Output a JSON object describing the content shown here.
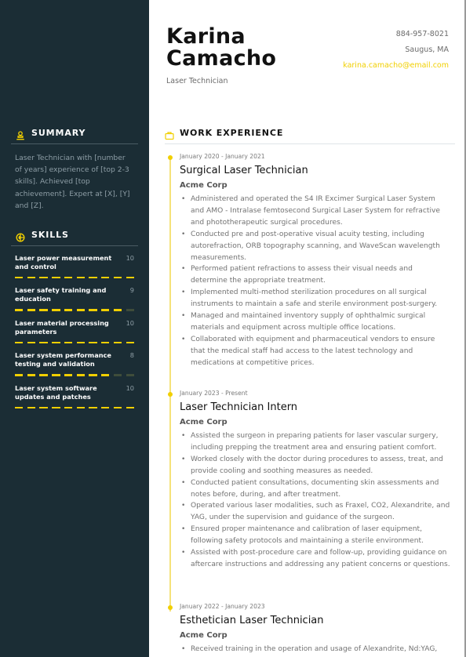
{
  "header": {
    "first_name": "Karina",
    "last_name": "Camacho",
    "role": "Laser Technician",
    "phone": "884-957-8021",
    "location": "Saugus, MA",
    "email": "karina.camacho@email.com"
  },
  "colors": {
    "sidebar_bg": "#1b2d35",
    "accent": "#f1cf00",
    "skill_off": "#3f4d3b"
  },
  "summary": {
    "heading": "SUMMARY",
    "icon": "user-icon",
    "text": "Laser Technician with [number of years] experience of [top 2-3 skills]. Achieved [top achievement]. Expert at [X], [Y] and [Z]."
  },
  "skills": {
    "heading": "SKILLS",
    "icon": "compass-icon",
    "max": 10,
    "items": [
      {
        "name": "Laser power measurement and control",
        "score": "10",
        "level": 10
      },
      {
        "name": "Laser safety training and education",
        "score": "9",
        "level": 9
      },
      {
        "name": "Laser material processing parameters",
        "score": "10",
        "level": 10
      },
      {
        "name": "Laser system performance testing and validation",
        "score": "8",
        "level": 8
      },
      {
        "name": "Laser system software updates and patches",
        "score": "10",
        "level": 10
      }
    ]
  },
  "work_experience": {
    "heading": "WORK EXPERIENCE",
    "icon": "briefcase-icon",
    "jobs": [
      {
        "dates": "January 2020 - January 2021",
        "title": "Surgical Laser Technician",
        "company": "Acme Corp",
        "bullets": [
          "Administered and operated the S4 IR Excimer Surgical Laser System and AMO - Intralase femtosecond Surgical Laser System for refractive and phototherapeutic surgical procedures.",
          "Conducted pre and post-operative visual acuity testing, including autorefraction, ORB topography scanning, and WaveScan wavelength measurements.",
          "Performed patient refractions to assess their visual needs and determine the appropriate treatment.",
          "Implemented multi-method sterilization procedures on all surgical instruments to maintain a safe and sterile environment post-surgery.",
          "Managed and maintained inventory supply of ophthalmic surgical materials and equipment across multiple office locations.",
          "Collaborated with equipment and pharmaceutical vendors to ensure that the medical staff had access to the latest technology and medications at competitive prices."
        ]
      },
      {
        "dates": "January 2023 - Present",
        "title": "Laser Technician Intern",
        "company": "Acme Corp",
        "bullets": [
          "Assisted the surgeon in preparing patients for laser vascular surgery, including prepping the treatment area and ensuring patient comfort.",
          "Worked closely with the doctor during procedures to assess, treat, and provide cooling and soothing measures as needed.",
          "Conducted patient consultations, documenting skin assessments and notes before, during, and after treatment.",
          "Operated various laser modalities, such as Fraxel, CO2, Alexandrite, and YAG, under the supervision and guidance of the surgeon.",
          "Ensured proper maintenance and calibration of laser equipment, following safety protocols and maintaining a sterile environment.",
          "Assisted with post-procedure care and follow-up, providing guidance on aftercare instructions and addressing any patient concerns or questions."
        ]
      },
      {
        "dates": "January 2022 - January 2023",
        "title": "Esthetician Laser Technician",
        "company": "Acme Corp",
        "bullets": [
          "Received training in the operation and usage of Alexandrite, Nd:YAG,"
        ]
      }
    ]
  }
}
